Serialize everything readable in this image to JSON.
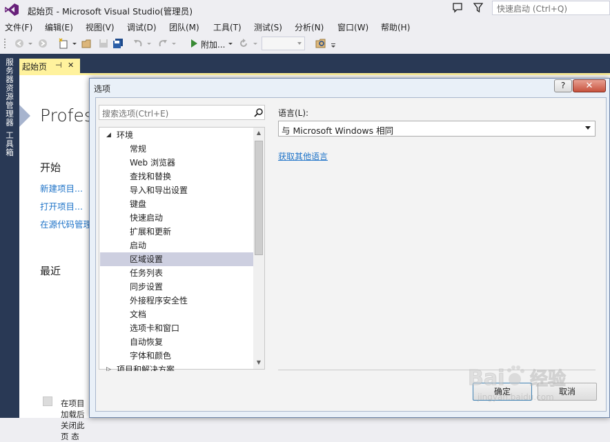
{
  "window": {
    "title": "起始页 - Microsoft Visual Studio(管理员)",
    "quick_launch_placeholder": "快速启动 (Ctrl+Q)"
  },
  "menu": [
    "文件(F)",
    "编辑(E)",
    "视图(V)",
    "调试(D)",
    "团队(M)",
    "工具(T)",
    "测试(S)",
    "分析(N)",
    "窗口(W)",
    "帮助(H)"
  ],
  "toolbar": {
    "attach_label": "附加..."
  },
  "side_tabs": [
    "服务器资源管理器",
    "工具箱"
  ],
  "doc_tab": {
    "label": "起始页",
    "pin": "⊣",
    "close": "✕"
  },
  "start_page": {
    "product_title": "Profess",
    "start_heading": "开始",
    "links": [
      "新建项目...",
      "打开项目...",
      "在源代码管理"
    ],
    "recent_heading": "最近",
    "show_on_startup_text": "在项目加载后关闭此页 态"
  },
  "dialog": {
    "title": "选项",
    "help_label": "?",
    "close_label": "✕",
    "search_placeholder": "搜索选项(Ctrl+E)",
    "tree": [
      {
        "label": "环境",
        "level": 0,
        "expander": "◢"
      },
      {
        "label": "常规",
        "level": 1
      },
      {
        "label": "Web 浏览器",
        "level": 1
      },
      {
        "label": "查找和替换",
        "level": 1
      },
      {
        "label": "导入和导出设置",
        "level": 1
      },
      {
        "label": "键盘",
        "level": 1
      },
      {
        "label": "快速启动",
        "level": 1
      },
      {
        "label": "扩展和更新",
        "level": 1
      },
      {
        "label": "启动",
        "level": 1
      },
      {
        "label": "区域设置",
        "level": 1,
        "selected": true
      },
      {
        "label": "任务列表",
        "level": 1
      },
      {
        "label": "同步设置",
        "level": 1
      },
      {
        "label": "外接程序安全性",
        "level": 1
      },
      {
        "label": "文档",
        "level": 1
      },
      {
        "label": "选项卡和窗口",
        "level": 1
      },
      {
        "label": "自动恢复",
        "level": 1
      },
      {
        "label": "字体和颜色",
        "level": 1
      },
      {
        "label": "项目和解决方案",
        "level": 0,
        "expander": "▷"
      }
    ],
    "language_label": "语言(L):",
    "language_value": "与 Microsoft Windows 相同",
    "get_languages_link": "获取其他语言",
    "ok_label": "确定",
    "cancel_label": "取消"
  },
  "watermark": {
    "text": "Bai 经验",
    "sub": "jingyan.baidu.com"
  },
  "colors": {
    "accent_tab": "#fff29d",
    "dock": "#293955",
    "link": "#1e73c8",
    "selection": "#cdcfe0"
  }
}
